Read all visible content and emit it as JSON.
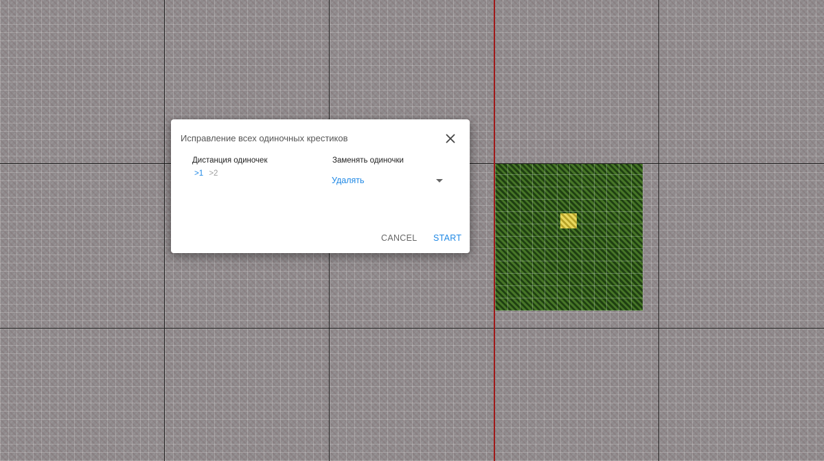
{
  "dialog": {
    "title": "Исправление всех одиночных крестиков",
    "close_icon": "close-icon",
    "distance": {
      "label": "Дистанция одиночек",
      "options": [
        {
          "label": ">1",
          "selected": true
        },
        {
          "label": ">2",
          "selected": false
        }
      ]
    },
    "replace": {
      "label": "Заменять одиночки",
      "value": "Удалять"
    },
    "buttons": {
      "cancel": "CANCEL",
      "start": "START"
    }
  },
  "colors": {
    "accent": "#1e88e5",
    "canvas_background": "#8f8a8c",
    "center_line": "#a01818",
    "stitch_green": "#2f5a1a",
    "stitch_yellow": "#c9b536"
  }
}
